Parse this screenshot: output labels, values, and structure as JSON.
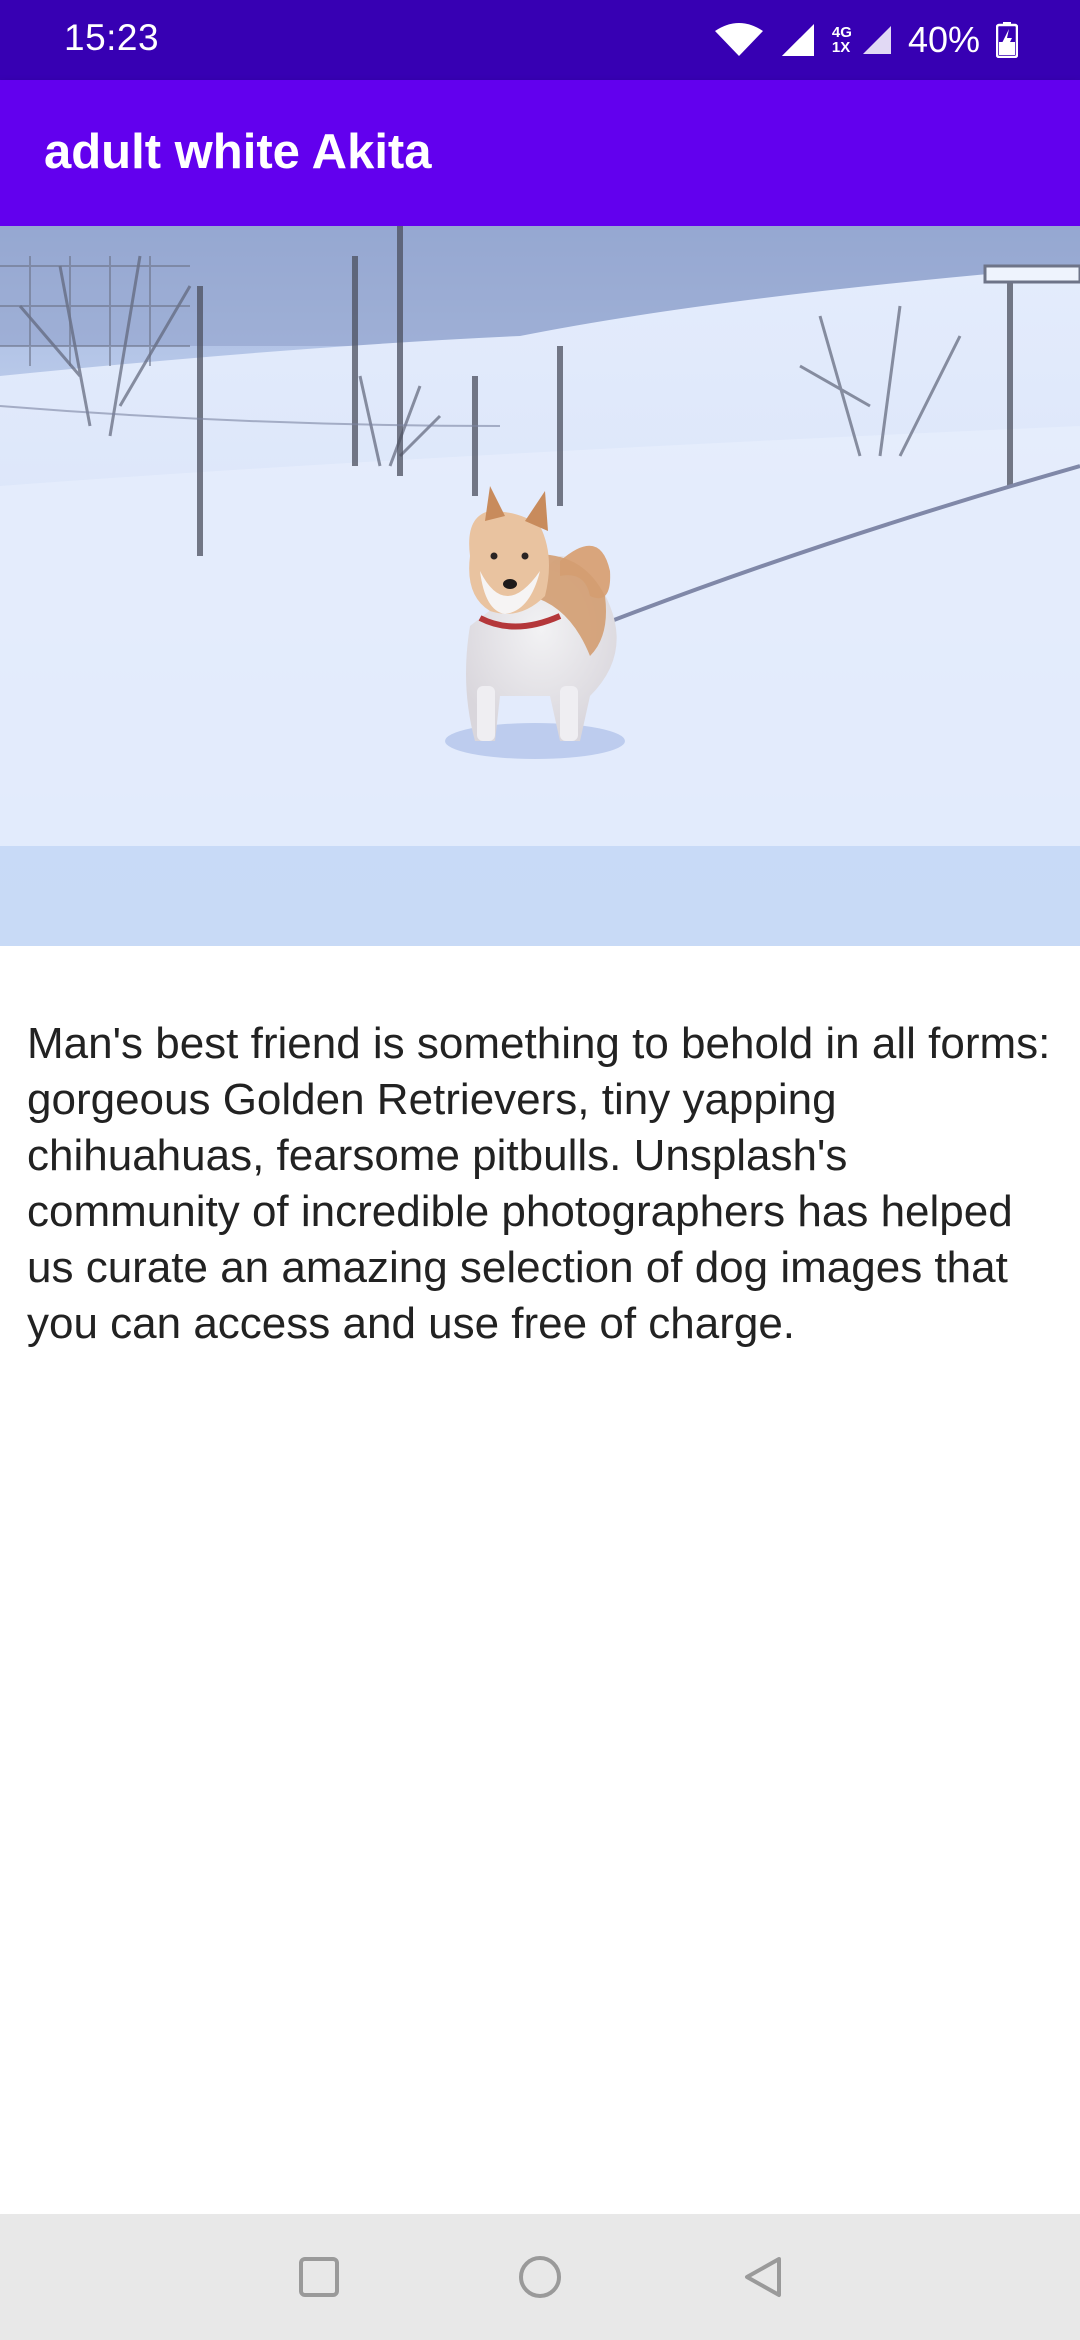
{
  "status_bar": {
    "time": "15:23",
    "network_top": "4G",
    "network_bottom": "1X",
    "battery": "40%"
  },
  "app_bar": {
    "title": "adult white Akita"
  },
  "hero_image": {
    "subject": "dog-in-snow-photo"
  },
  "content": {
    "description": "Man's best friend is something to behold in all forms: gorgeous Golden Retrievers, tiny yapping chihuahuas, fearsome pitbulls. Unsplash's community of incredible photographers has helped us curate an amazing selection of dog images that you can access and use free of charge."
  },
  "nav_bar": {
    "buttons": [
      "recents",
      "home",
      "back"
    ]
  },
  "colors": {
    "status_bar": "#3700b3",
    "app_bar": "#6200ee",
    "nav_bar": "#e8e8e8"
  }
}
